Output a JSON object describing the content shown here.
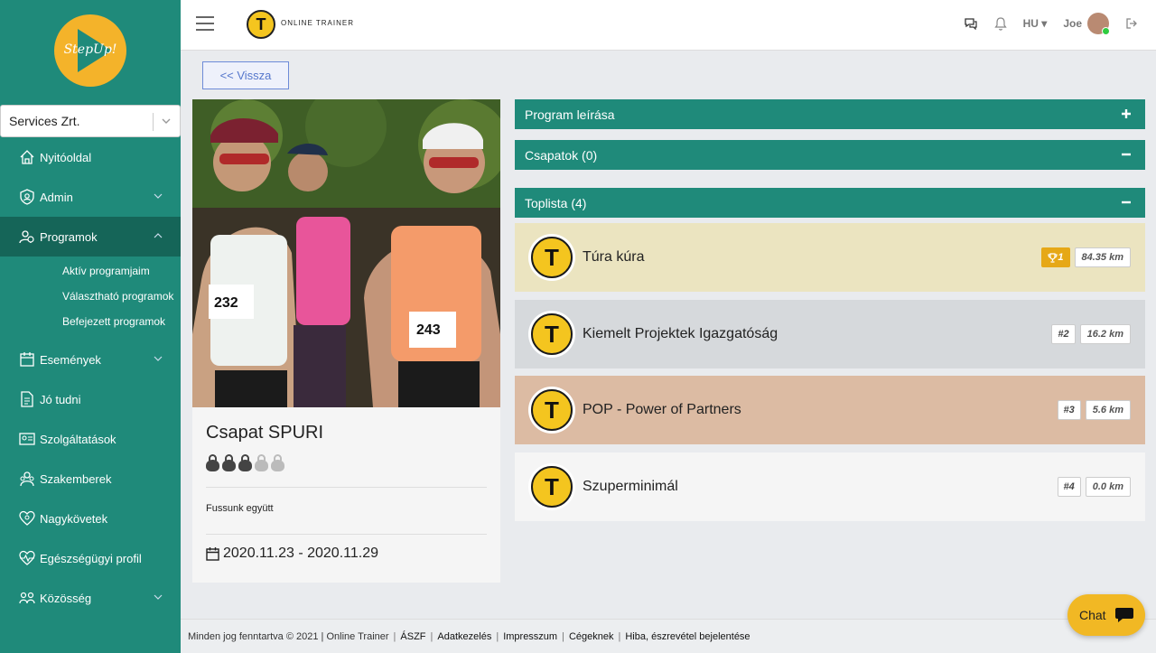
{
  "sidebar": {
    "logo_text": "StepUp!",
    "company_select": "Services Zrt.",
    "items": [
      {
        "label": "Nyitóoldal"
      },
      {
        "label": "Admin"
      },
      {
        "label": "Programok"
      },
      {
        "label": "Események"
      },
      {
        "label": "Jó tudni"
      },
      {
        "label": "Szolgáltatások"
      },
      {
        "label": "Szakemberek"
      },
      {
        "label": "Nagykövetek"
      },
      {
        "label": "Egészségügyi profil"
      },
      {
        "label": "Közösség"
      }
    ],
    "programok_sub": [
      "Aktív programjaim",
      "Választható programok",
      "Befejezett programok"
    ]
  },
  "topbar": {
    "brand_letter": "T",
    "brand_name": "ONLINE TRAINER",
    "lang": "HU",
    "user": "Joe"
  },
  "back_label": "<<   Vissza",
  "card": {
    "title": "Csapat SPURI",
    "difficulty_filled": 3,
    "difficulty_total": 5,
    "description": "Fussunk együtt",
    "dates": "2020.11.23 - 2020.11.29",
    "photo_bibs": [
      "232",
      "243"
    ]
  },
  "panels": {
    "program_desc": "Program leírása",
    "teams": "Csapatok (0)",
    "toplist": "Toplista (4)"
  },
  "ranking": [
    {
      "name": "Túra kúra",
      "pos": "1",
      "km": "84.35 km",
      "bg": "#ebe4c0"
    },
    {
      "name": "Kiemelt Projektek Igazgatóság",
      "pos": "#2",
      "km": "16.2 km",
      "bg": "#d6d9dc"
    },
    {
      "name": "POP - Power of Partners",
      "pos": "#3",
      "km": "5.6 km",
      "bg": "#dcbba3"
    },
    {
      "name": "Szuperminimál",
      "pos": "#4",
      "km": "0.0 km",
      "bg": "#f5f5f5"
    }
  ],
  "footer": {
    "copyright": "Minden jog fenntartva © 2021 | Online Trainer",
    "links": [
      "ÁSZF",
      "Adatkezelés",
      "Impresszum",
      "Cégeknek",
      "Hiba, észrevétel bejelentése"
    ]
  },
  "chat_label": "Chat",
  "colors": {
    "primary": "#1f8a7a",
    "active": "#156558",
    "accent": "#f4c51f",
    "gold": "#e6a817"
  }
}
